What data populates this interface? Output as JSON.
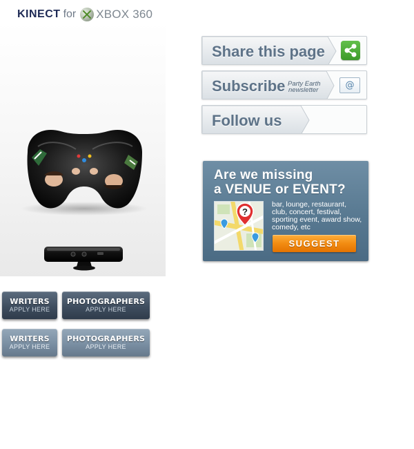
{
  "ad": {
    "brand": "KINECT",
    "connector": "for",
    "platform_name": "XBOX",
    "platform_number": "360"
  },
  "share": {
    "title": "Share this page",
    "icon": "share-icon",
    "icon_color": "#4cae38"
  },
  "subscribe": {
    "title": "Subscribe",
    "note_line1": "Party Earth",
    "note_line2": "newsletter",
    "icon": "envelope-at-icon"
  },
  "follow": {
    "title": "Follow us"
  },
  "missing": {
    "title_line1": "Are we missing",
    "title_line2": "a VENUE or EVENT?",
    "description": "bar, lounge, restaurant, club, concert, festival, sporting event, award show, comedy, etc",
    "button_label": "SUGGEST",
    "button_color": "#f28c12"
  },
  "apply_buttons": {
    "writers_label": "WRITERS",
    "photographers_label": "PHOTOGRAPHERS",
    "apply_label": "APPLY HERE"
  },
  "colors": {
    "bar_title": "#5e7388",
    "apply_button_dark": "#3f4e5f",
    "apply_button_light": "#7a8fa3",
    "missing_box": "#587991"
  }
}
